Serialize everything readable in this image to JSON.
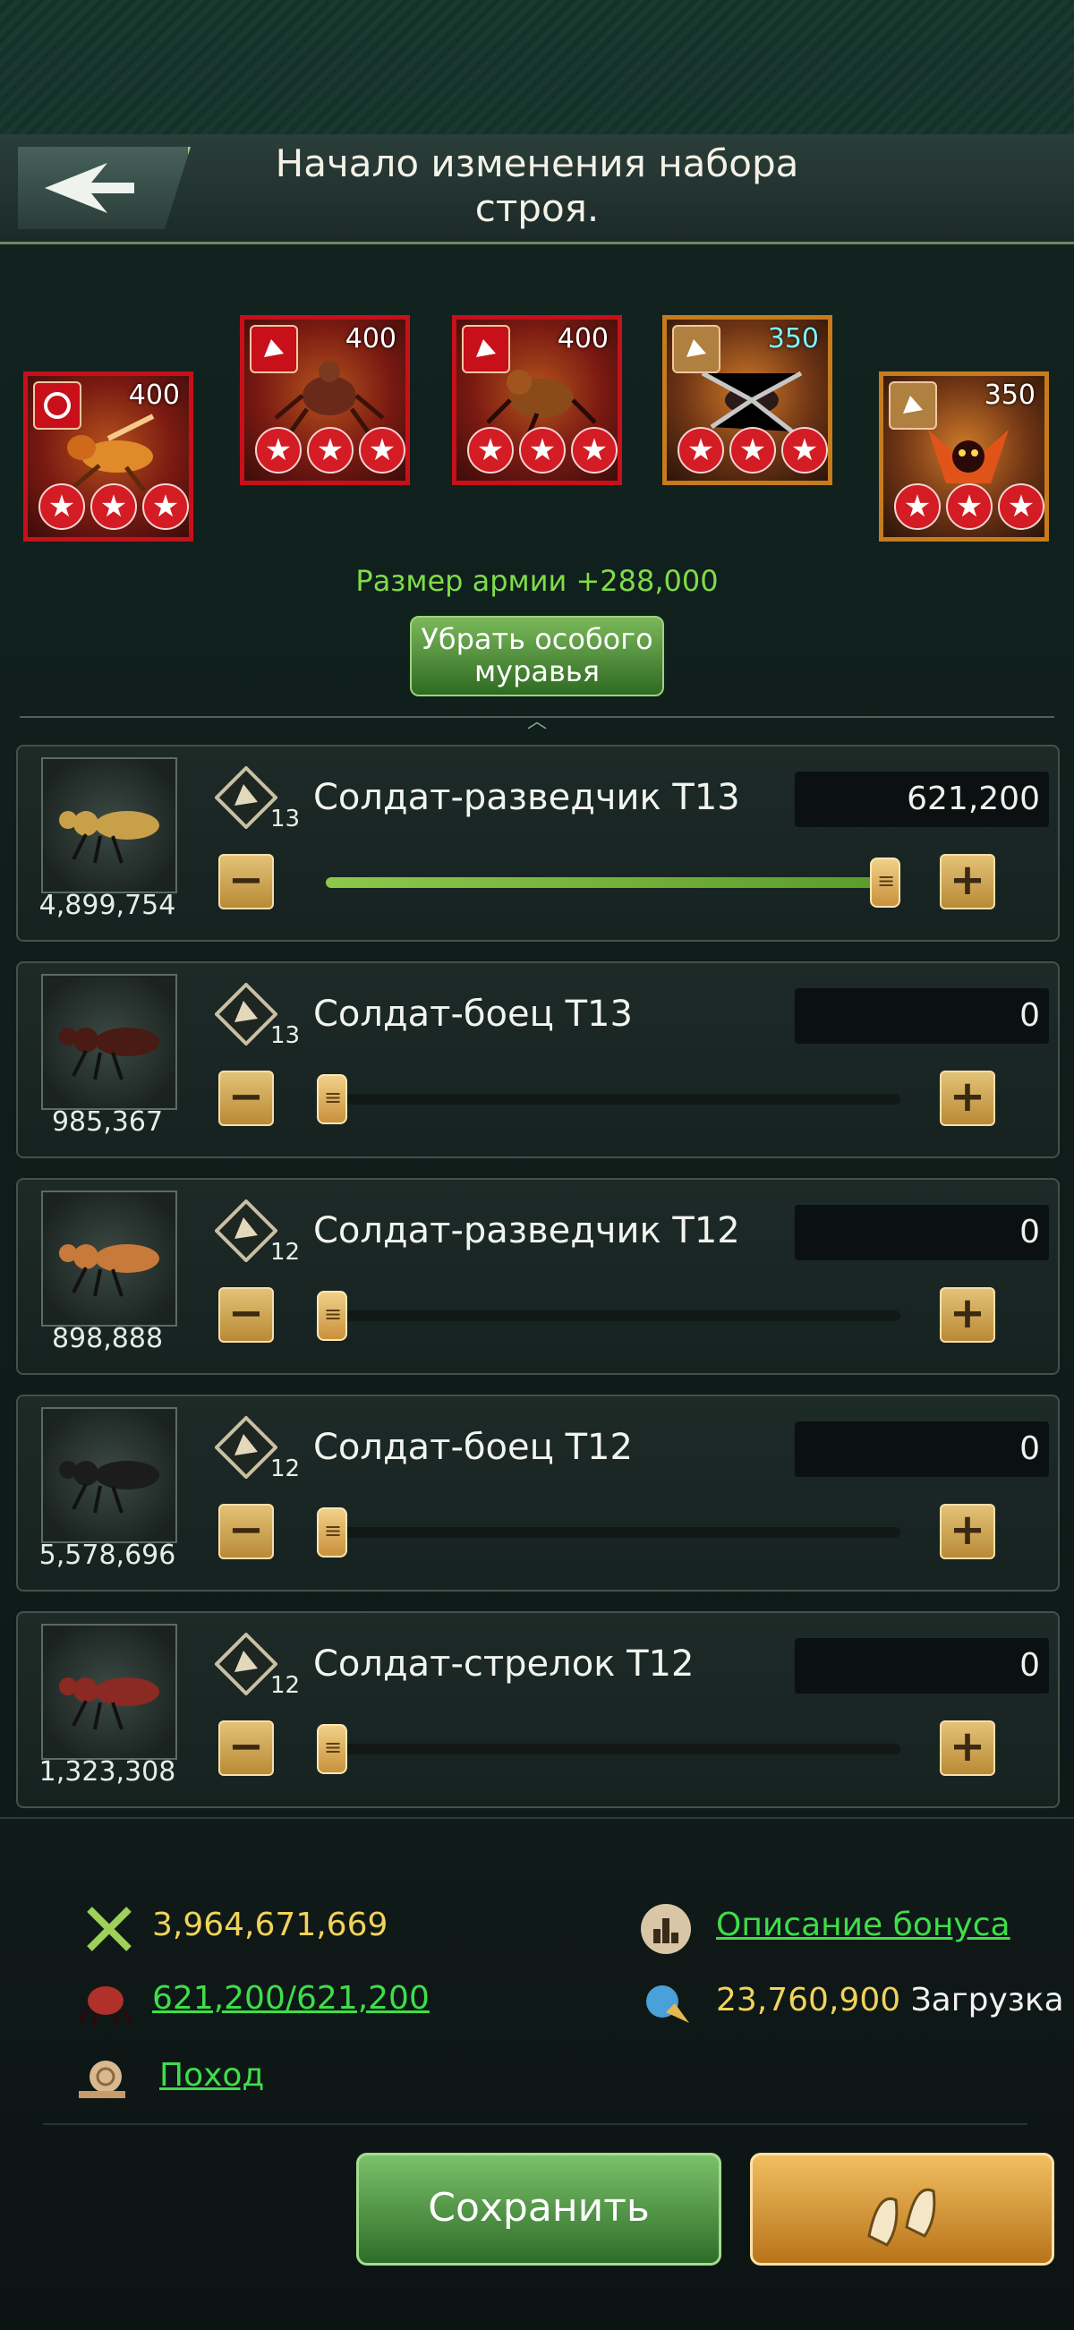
{
  "header": {
    "title": "Начало изменения набора строя."
  },
  "heroes": [
    {
      "level": "400",
      "frame": "red"
    },
    {
      "level": "400",
      "frame": "red"
    },
    {
      "level": "400",
      "frame": "red"
    },
    {
      "level": "350",
      "frame": "gold"
    },
    {
      "level": "350",
      "frame": "gold"
    }
  ],
  "army": {
    "size_text": "Размер армии +288,000",
    "remove_button": "Убрать особого муравья"
  },
  "troops": [
    {
      "name": "Солдат-разведчик T13",
      "tier": "13",
      "available": "4,899,754",
      "value": "621,200",
      "fill": 1.0
    },
    {
      "name": "Солдат-боец T13",
      "tier": "13",
      "available": "985,367",
      "value": "0",
      "fill": 0
    },
    {
      "name": "Солдат-разведчик T12",
      "tier": "12",
      "available": "898,888",
      "value": "0",
      "fill": 0
    },
    {
      "name": "Солдат-боец T12",
      "tier": "12",
      "available": "5,578,696",
      "value": "0",
      "fill": 0
    },
    {
      "name": "Солдат-стрелок T12",
      "tier": "12",
      "available": "1,323,308",
      "value": "0",
      "fill": 0
    }
  ],
  "summary": {
    "power": "3,964,671,669",
    "troops": "621,200/621,200",
    "march": "Поход",
    "bonus_link": "Описание бонуса",
    "load_value": "23,760,900",
    "load_label": "Загрузка"
  },
  "actions": {
    "save": "Сохранить"
  },
  "colors": {
    "accent_green": "#7fdc48",
    "link_green": "#3ede4a",
    "gold": "#f2d35a",
    "hero_red": "#c8101a"
  }
}
